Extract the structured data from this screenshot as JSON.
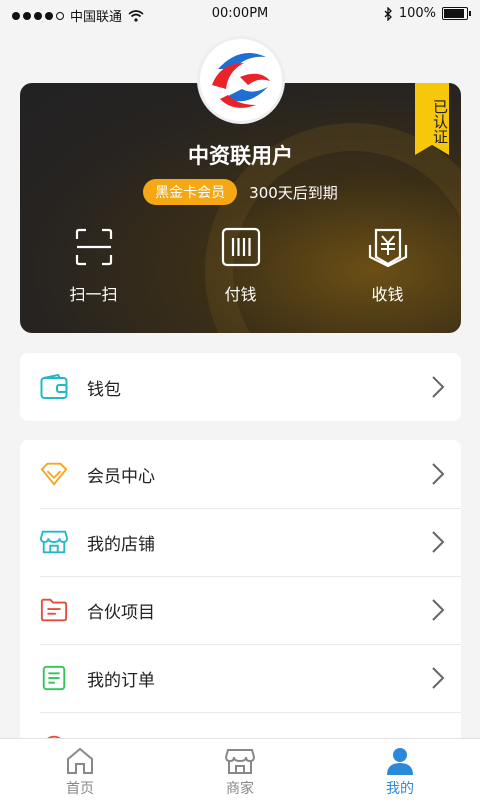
{
  "status_bar": {
    "carrier": "中国联通",
    "time": "00:00PM",
    "battery": "100%",
    "battery_level": 1.0
  },
  "profile": {
    "verified_label": "已认证",
    "username": "中资联用户",
    "member_badge": "黑金卡会员",
    "expire_text": "300天后到期",
    "actions": [
      {
        "label": "扫一扫",
        "icon": "scan-icon"
      },
      {
        "label": "付钱",
        "icon": "pay-icon"
      },
      {
        "label": "收钱",
        "icon": "receive-money-icon"
      }
    ]
  },
  "wallet": {
    "label": "钱包",
    "icon": "wallet-icon"
  },
  "menu": [
    {
      "label": "会员中心",
      "icon": "diamond-icon",
      "color": "#f5a623"
    },
    {
      "label": "我的店铺",
      "icon": "store-icon",
      "color": "#22b8c8"
    },
    {
      "label": "合伙项目",
      "icon": "folder-icon",
      "color": "#e84a3c"
    },
    {
      "label": "我的订单",
      "icon": "order-icon",
      "color": "#2ec45a"
    }
  ],
  "tabs": [
    {
      "label": "首页",
      "icon": "home-icon"
    },
    {
      "label": "商家",
      "icon": "shop-icon"
    },
    {
      "label": "我的",
      "icon": "user-icon",
      "active": true
    }
  ],
  "colors": {
    "accent": "#2a8ad9",
    "badge": "#f5a814",
    "ribbon": "#f6c70b"
  }
}
